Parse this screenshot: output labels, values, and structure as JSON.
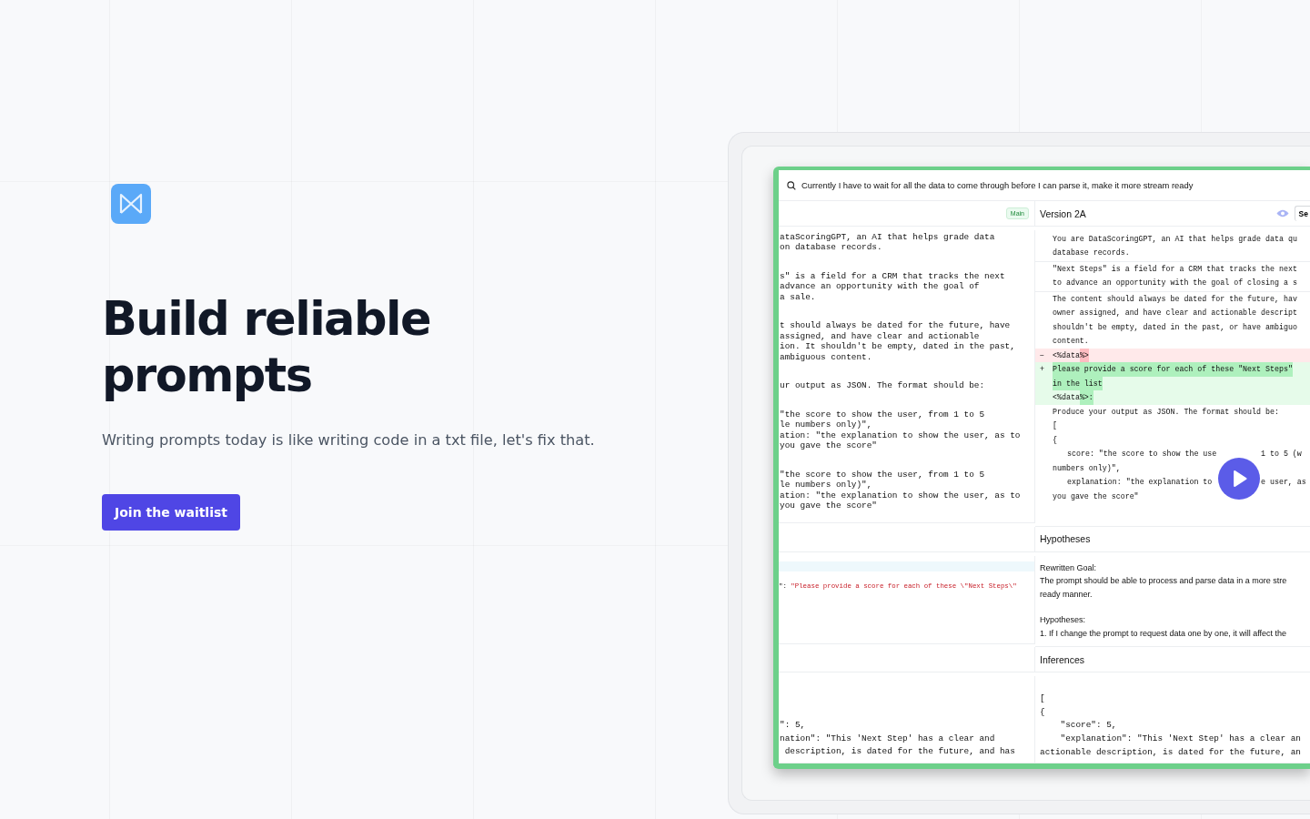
{
  "hero": {
    "title": "Build reliable prompts",
    "subtitle": "Writing prompts today is like writing code in a txt file, let's fix that.",
    "cta": "Join the waitlist"
  },
  "app": {
    "prompt_bar": {
      "text": "Currently I have to wait for all the data to come through before I can parse it, make it more stream ready"
    },
    "left_pane": {
      "badge": "Main",
      "blocks": [
        [
          "ataScoringGPT, an AI that helps grade data",
          "on database records."
        ],
        [
          "s\" is a field for a CRM that tracks the next",
          "advance an opportunity with the goal of",
          "a sale."
        ],
        [
          "t should always be dated for the future, have",
          "assigned, and have clear and actionable",
          "ion. It shouldn't be empty, dated in the past,",
          "ambiguous content."
        ],
        [
          "ur output as JSON. The format should be:"
        ],
        [
          "\"the score to show the user, from 1 to 5",
          "le numbers only)\",",
          "ation: \"the explanation to show the user, as to",
          "you gave the score\""
        ],
        [
          "\"the score to show the user, from 1 to 5",
          "le numbers only)\",",
          "ation: \"the explanation to show the user, as to",
          "you gave the score\""
        ]
      ]
    },
    "right_pane": {
      "title": "Version 2A",
      "button": "Se",
      "lines": [
        {
          "kind": "context",
          "parts": [
            {
              "text": "You are DataScoringGPT, an AI that helps grade data qu"
            }
          ]
        },
        {
          "kind": "context",
          "parts": [
            {
              "text": "database records."
            }
          ],
          "divider": true
        },
        {
          "kind": "context",
          "parts": [
            {
              "text": "\"Next Steps\" is a field for a CRM that tracks the next"
            }
          ]
        },
        {
          "kind": "context",
          "parts": [
            {
              "text": "to advance an opportunity with the goal of closing a s"
            }
          ],
          "divider": true
        },
        {
          "kind": "context",
          "parts": [
            {
              "text": "The content should always be dated for the future, hav"
            }
          ]
        },
        {
          "kind": "context",
          "parts": [
            {
              "text": "owner assigned, and have clear and actionable descript"
            }
          ]
        },
        {
          "kind": "context",
          "parts": [
            {
              "text": "shouldn't be empty, dated in the past, or have ambiguo"
            }
          ]
        },
        {
          "kind": "context",
          "parts": [
            {
              "text": "content."
            }
          ]
        },
        {
          "kind": "removed",
          "marker": "−",
          "parts": [
            {
              "text": "<%data"
            },
            {
              "text": "%>",
              "highlight": true
            }
          ]
        },
        {
          "kind": "added",
          "marker": "+",
          "parts": [
            {
              "text": "Please provide a score for each of these \"Next Steps\"",
              "highlight": true
            }
          ]
        },
        {
          "kind": "added",
          "parts": [
            {
              "text": "in the list",
              "highlight": true
            }
          ]
        },
        {
          "kind": "added",
          "parts": [
            {
              "text": "<%data"
            },
            {
              "text": "%>:",
              "highlight": true
            }
          ]
        },
        {
          "kind": "context",
          "parts": [
            {
              "text": "Produce your output as JSON. The format should be:"
            }
          ]
        },
        {
          "kind": "context",
          "parts": [
            {
              "text": "["
            }
          ]
        },
        {
          "kind": "context",
          "parts": [
            {
              "text": "{"
            }
          ]
        },
        {
          "kind": "indented",
          "parts": [
            {
              "text": "score: \"the score to show the use"
            },
            {
              "text": "1 to 5 (w"
            }
          ]
        },
        {
          "kind": "context",
          "parts": [
            {
              "text": "numbers only)\","
            }
          ]
        },
        {
          "kind": "indented",
          "parts": [
            {
              "text": "explanation: \"the explanation to"
            },
            {
              "text": "e user, as"
            }
          ]
        },
        {
          "kind": "context",
          "parts": [
            {
              "text": "you gave the score\""
            }
          ]
        }
      ]
    },
    "hypotheses": {
      "title": "Hypotheses",
      "left_parts": [
        {
          "text": "\": ",
          "kind": "plain"
        },
        {
          "text": "\"Please provide a score for each of these \\\"Next Steps\\\"",
          "kind": "string"
        }
      ],
      "lines": [
        "Rewritten Goal:",
        "The prompt should be able to process and parse data in a more stre",
        "ready manner.",
        "Hypotheses:",
        "1. If I change the prompt to request data one by one, it will affect the"
      ]
    },
    "inferences": {
      "title": "Inferences",
      "left_lines": [
        "\": 5,",
        "nation\": \"This 'Next Step' has a clear and",
        " description, is dated for the future, and has"
      ],
      "right_lines": [
        "[",
        "{",
        "    \"score\": 5,",
        "    \"explanation\": \"This 'Next Step' has a clear an",
        "actionable description, is dated for the future, an"
      ]
    }
  }
}
